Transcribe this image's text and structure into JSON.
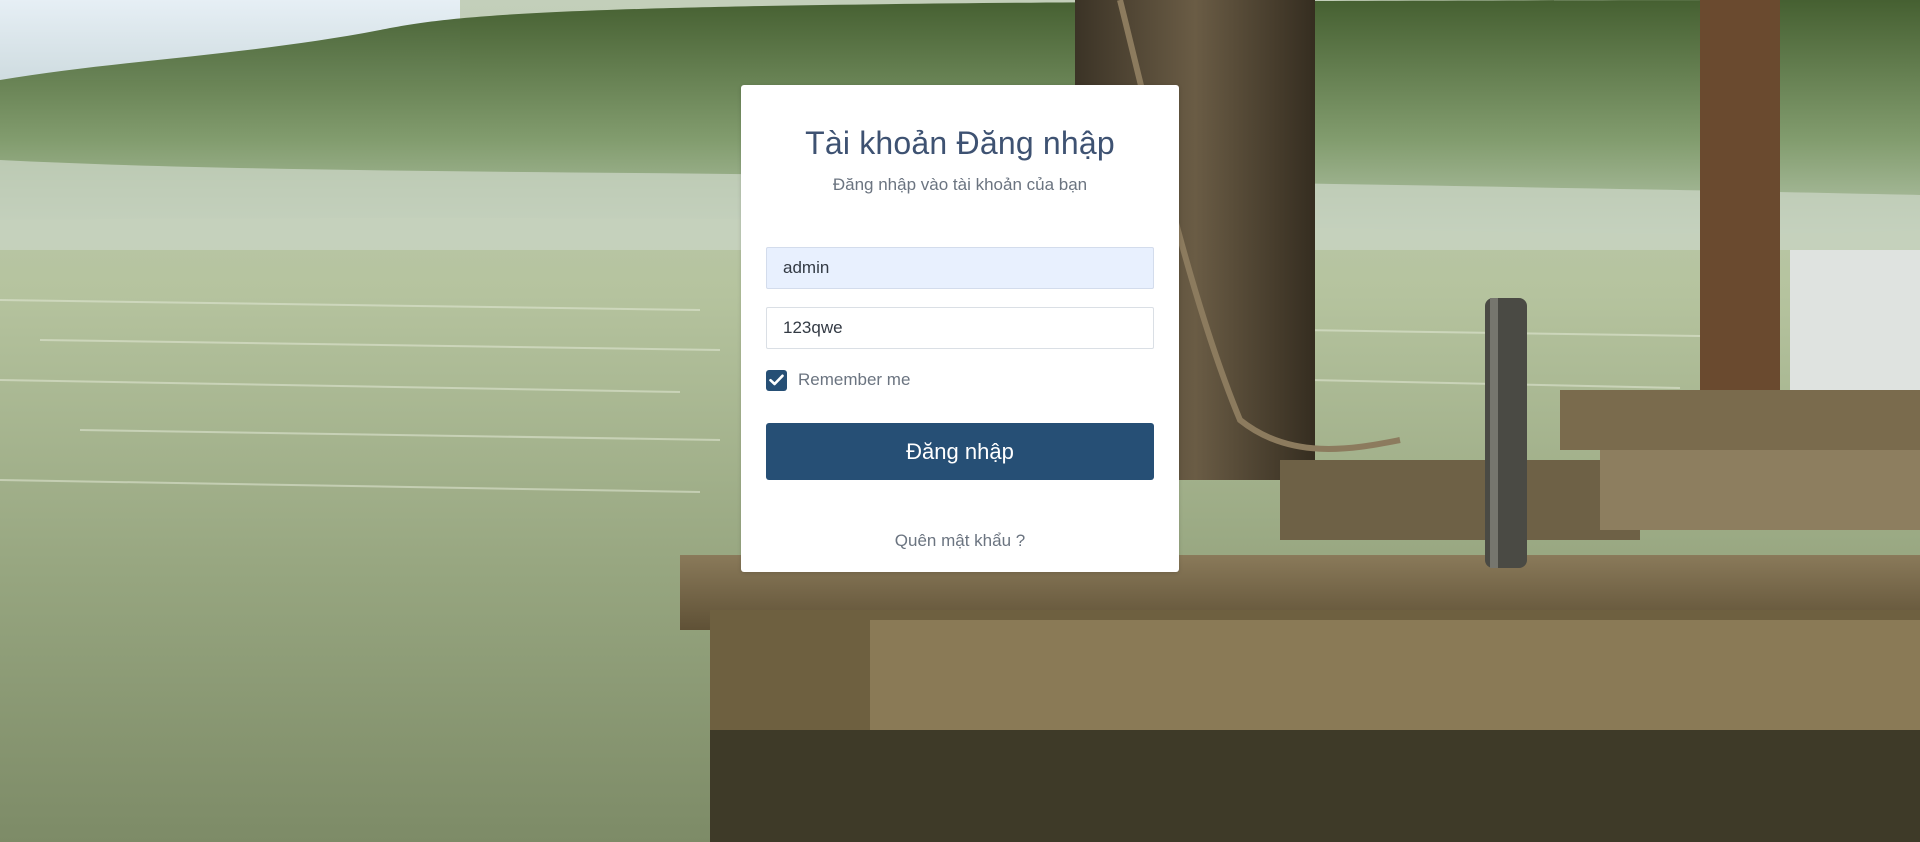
{
  "login": {
    "title": "Tài khoản Đăng nhập",
    "subtitle": "Đăng nhập vào tài khoản của bạn",
    "username": {
      "value": "admin"
    },
    "password": {
      "value": "123qwe"
    },
    "remember": {
      "label": "Remember me",
      "checked": true
    },
    "submit_label": "Đăng nhập",
    "forgot_label": "Quên mật khẩu ?"
  },
  "colors": {
    "primary": "#264f75",
    "title": "#3e5272",
    "muted": "#6b7480",
    "autofill_bg": "#e8f0fe"
  },
  "icons": {
    "checkbox": "check-icon"
  }
}
